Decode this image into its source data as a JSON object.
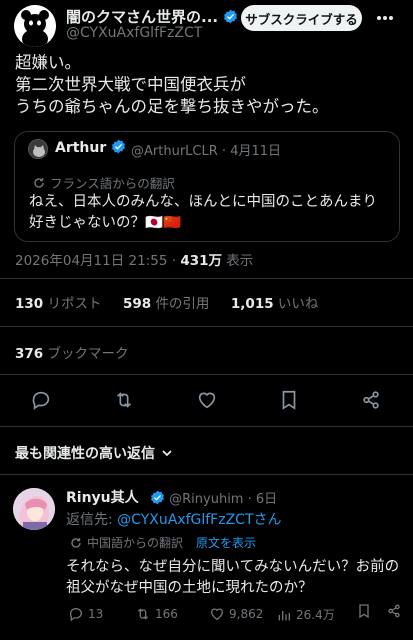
{
  "post": {
    "author_name": "闇のクマさん世界の...",
    "author_handle": "@CYXuAxfGlfFzZCT",
    "subscribe_label": "サブスクライブする",
    "text": "超嫌い。\n第二次世界大戦で中国便衣兵が\nうちの爺ちゃんの足を撃ち抜きやがった。",
    "date": "2026年04月11日 21:55",
    "separator": "·",
    "views": "431万",
    "views_label": "表示"
  },
  "quote": {
    "name": "Arthur",
    "handle": "@ArthurLCLR",
    "date": "4月11日",
    "translate_label": "フランス語からの翻訳",
    "text": "ねえ、日本人のみんな、ほんとに中国のことあんまり好きじゃないの？🇯🇵🇨🇳"
  },
  "stats": {
    "reposts": "130",
    "reposts_label": "リポスト",
    "quotes": "598",
    "quotes_label": "件の引用",
    "likes": "1,015",
    "likes_label": "いいね",
    "bookmarks": "376",
    "bookmarks_label": "ブックマーク"
  },
  "relevant_replies_label": "最も関連性の高い返信",
  "reply": {
    "name": "Rinyu其人",
    "handle": "@Rinyuhim",
    "date": "6日",
    "reply_to_label": "返信先:",
    "reply_to_handle": "@CYXuAxfGlfFzZCTさん",
    "translate_label": "中国語からの翻訳",
    "show_original_label": "原文を表示",
    "text": "それなら、なぜ自分に聞いてみないんだい？お前の祖父がなぜ中国の土地に現れたのか？",
    "replies": "13",
    "reposts": "166",
    "likes": "9,862",
    "views": "26.4万"
  },
  "colors": {
    "background": "#000000",
    "text": "#e7e9ea",
    "muted": "#71767b",
    "accent": "#1d9bf0",
    "border": "#2f3336"
  },
  "icons": {
    "verified": "verified-badge-icon",
    "more": "more-options-icon",
    "translate": "translate-icon",
    "reply": "reply-icon",
    "repost": "repost-icon",
    "like": "heart-icon",
    "bookmark": "bookmark-icon",
    "share": "share-icon",
    "views": "views-icon"
  }
}
